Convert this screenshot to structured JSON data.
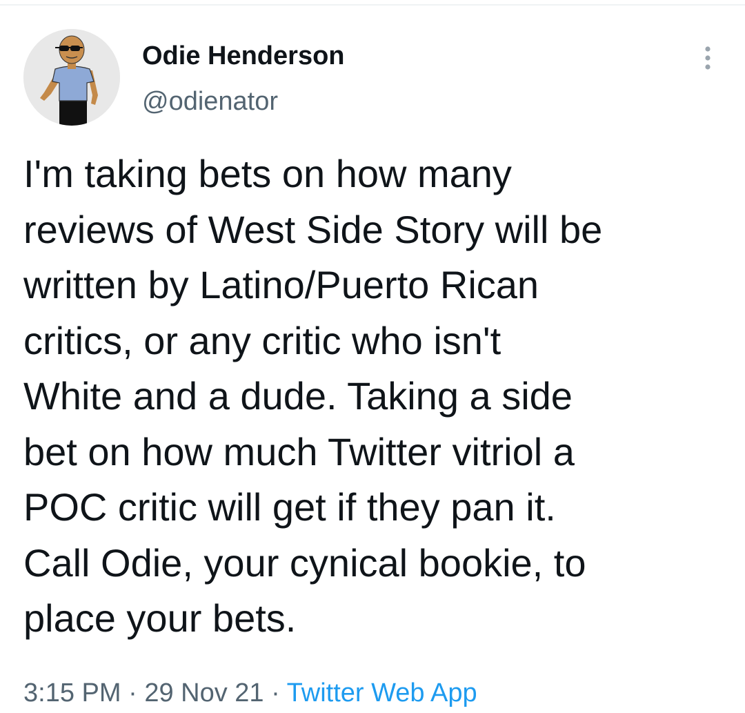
{
  "user": {
    "display_name": "Odie Henderson",
    "handle": "@odienator",
    "avatar_icon": "cartoon-avatar-icon"
  },
  "more_icon": "more-vertical-icon",
  "tweet": {
    "lines": [
      "I'm taking bets on how many",
      "reviews of West Side Story will be",
      "written by Latino/Puerto Rican",
      "critics, or any critic who isn't",
      "White and a dude. Taking a side",
      "bet on how much Twitter vitriol a",
      "POC critic will get if they pan it.",
      "Call Odie, your cynical bookie, to",
      "place your bets."
    ]
  },
  "meta": {
    "time": "3:15 PM",
    "separator": " · ",
    "date": "29 Nov 21",
    "source": "Twitter Web App"
  },
  "colors": {
    "text": "#0f1419",
    "secondary": "#536471",
    "link": "#1d9bf0"
  }
}
